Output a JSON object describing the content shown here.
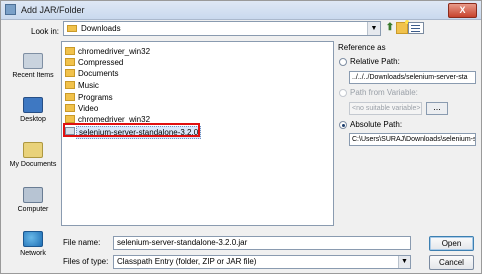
{
  "window": {
    "title": "Add JAR/Folder",
    "close_label": "X"
  },
  "toolbar": {
    "lookin_label": "Look in:",
    "lookin_value": "Downloads",
    "icons": [
      "up-folder-icon",
      "new-folder-icon",
      "view-menu-icon"
    ]
  },
  "places": [
    {
      "label": "Recent Items",
      "icon": "recent-items-icon"
    },
    {
      "label": "Desktop",
      "icon": "desktop-icon"
    },
    {
      "label": "My Documents",
      "icon": "my-documents-icon"
    },
    {
      "label": "Computer",
      "icon": "computer-icon"
    },
    {
      "label": "Network",
      "icon": "network-icon"
    }
  ],
  "files": [
    {
      "name": "chromedriver_win32",
      "type": "folder"
    },
    {
      "name": "Compressed",
      "type": "folder"
    },
    {
      "name": "Documents",
      "type": "folder"
    },
    {
      "name": "Music",
      "type": "folder"
    },
    {
      "name": "Programs",
      "type": "folder"
    },
    {
      "name": "Video",
      "type": "folder"
    },
    {
      "name": "chromedriver_win32",
      "type": "folder"
    },
    {
      "name": "selenium-server-standalone-3.2.0",
      "type": "jar",
      "selected": true
    }
  ],
  "reference": {
    "title": "Reference as",
    "relative_label": "Relative Path:",
    "relative_value": "../../../Downloads/selenium-server-sta",
    "variable_label": "Path from Variable:",
    "variable_value": "<no suitable variable>",
    "variable_button": "...",
    "absolute_label": "Absolute Path:",
    "absolute_value": "C:\\Users\\SURAJ\\Downloads\\selenium-s",
    "selected": "absolute"
  },
  "bottom": {
    "filename_label": "File name:",
    "filename_value": "selenium-server-standalone-3.2.0.jar",
    "filetype_label": "Files of type:",
    "filetype_value": "Classpath Entry (folder, ZIP or JAR file)",
    "open_label": "Open",
    "cancel_label": "Cancel"
  }
}
